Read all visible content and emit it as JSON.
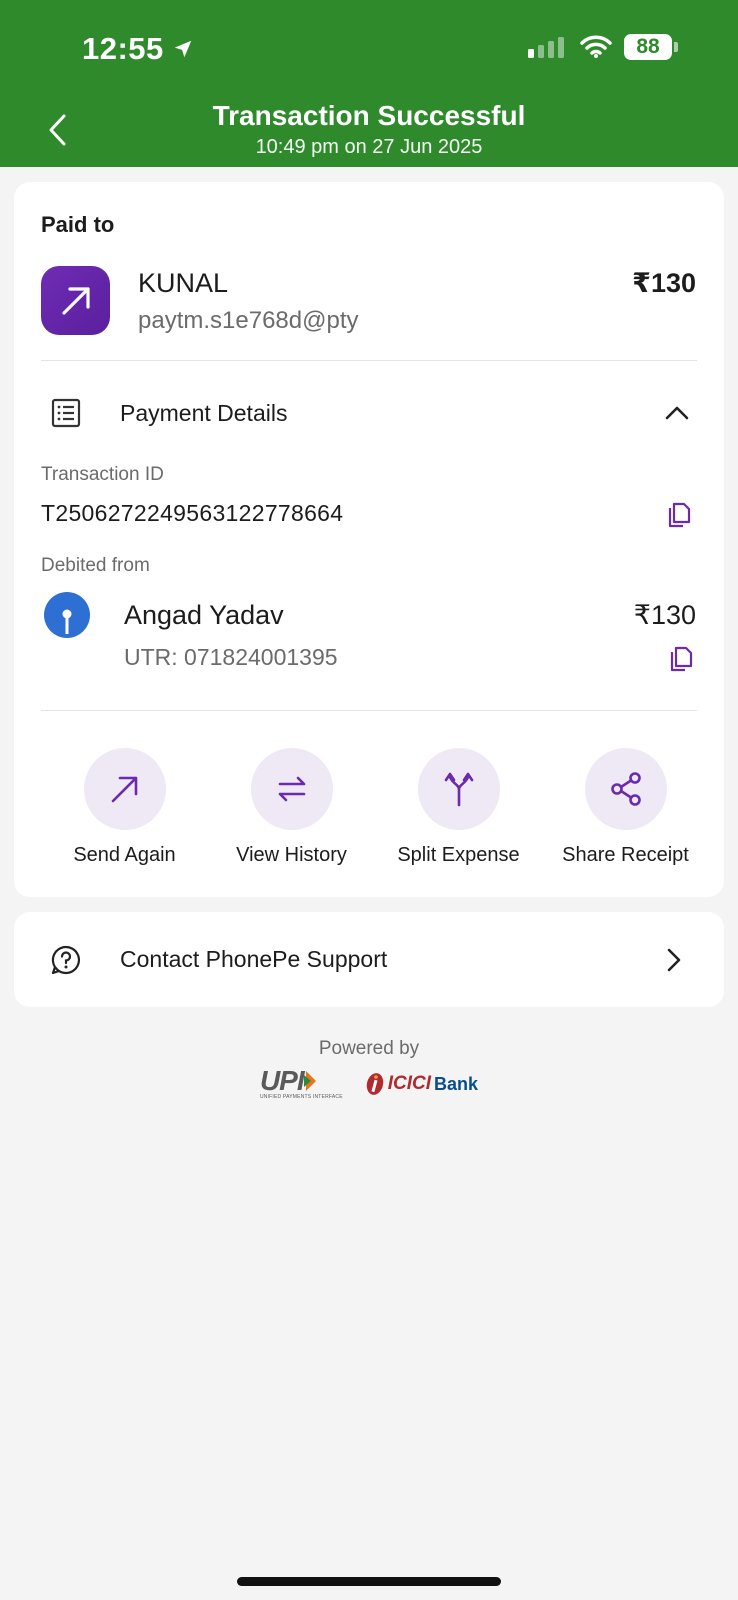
{
  "status_bar": {
    "time": "12:55",
    "battery": "88"
  },
  "header": {
    "title": "Transaction Successful",
    "subtitle": "10:49 pm on 27 Jun 2025",
    "bg_color": "#2f8a2c"
  },
  "payee": {
    "section_label": "Paid to",
    "name": "KUNAL",
    "upi_id": "paytm.s1e768d@pty",
    "amount": "₹130",
    "icon": "arrow-up-right-icon"
  },
  "payment_details": {
    "label": "Payment Details",
    "expanded": true,
    "transaction_id_label": "Transaction ID",
    "transaction_id": "T2506272249563122778664",
    "debited_from_label": "Debited from",
    "account_name": "Angad Yadav",
    "utr": "UTR: 071824001395",
    "debit_amount": "₹130"
  },
  "actions": [
    {
      "label": "Send Again",
      "icon": "send-again-icon"
    },
    {
      "label": "View History",
      "icon": "view-history-icon"
    },
    {
      "label": "Split Expense",
      "icon": "split-expense-icon"
    },
    {
      "label": "Share Receipt",
      "icon": "share-icon"
    }
  ],
  "support": {
    "label": "Contact PhonePe Support"
  },
  "footer": {
    "powered_by": "Powered by",
    "upi_text": "UPI",
    "upi_subtext": "UNIFIED PAYMENTS INTERFACE",
    "bank_brand": "ICICI",
    "bank_word": "Bank"
  },
  "colors": {
    "accent_purple": "#6a2bb0",
    "action_bg": "#efe9f5",
    "sbi_blue": "#2d6fd2"
  }
}
